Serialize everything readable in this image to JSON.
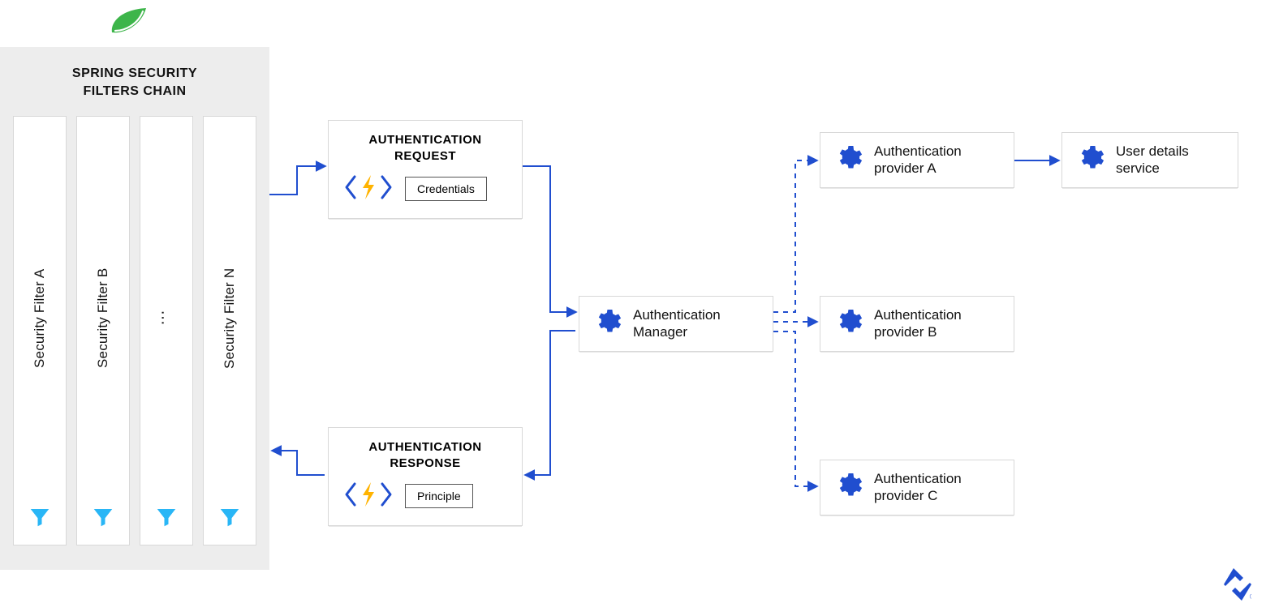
{
  "filters_panel": {
    "title_line1": "SPRING SECURITY",
    "title_line2": "FILTERS CHAIN",
    "columns": [
      {
        "label": "Security Filter A"
      },
      {
        "label": "Security Filter B"
      },
      {
        "label": "…",
        "ellipsis": true
      },
      {
        "label": "Security Filter N"
      }
    ]
  },
  "auth_request": {
    "title_line1": "AUTHENTICATION",
    "title_line2": "REQUEST",
    "tag": "Credentials"
  },
  "auth_response": {
    "title_line1": "AUTHENTICATION",
    "title_line2": "RESPONSE",
    "tag": "Principle"
  },
  "auth_manager": {
    "label": "Authentication\nManager"
  },
  "provider_a": {
    "label": "Authentication\nprovider A"
  },
  "provider_b": {
    "label": "Authentication\nprovider B"
  },
  "provider_c": {
    "label": "Authentication\nprovider C"
  },
  "user_details": {
    "label": "User details\nservice"
  },
  "colors": {
    "blue": "#204ecf",
    "cyan": "#29b6f6",
    "amber": "#ffb300",
    "green": "#3db54a"
  }
}
